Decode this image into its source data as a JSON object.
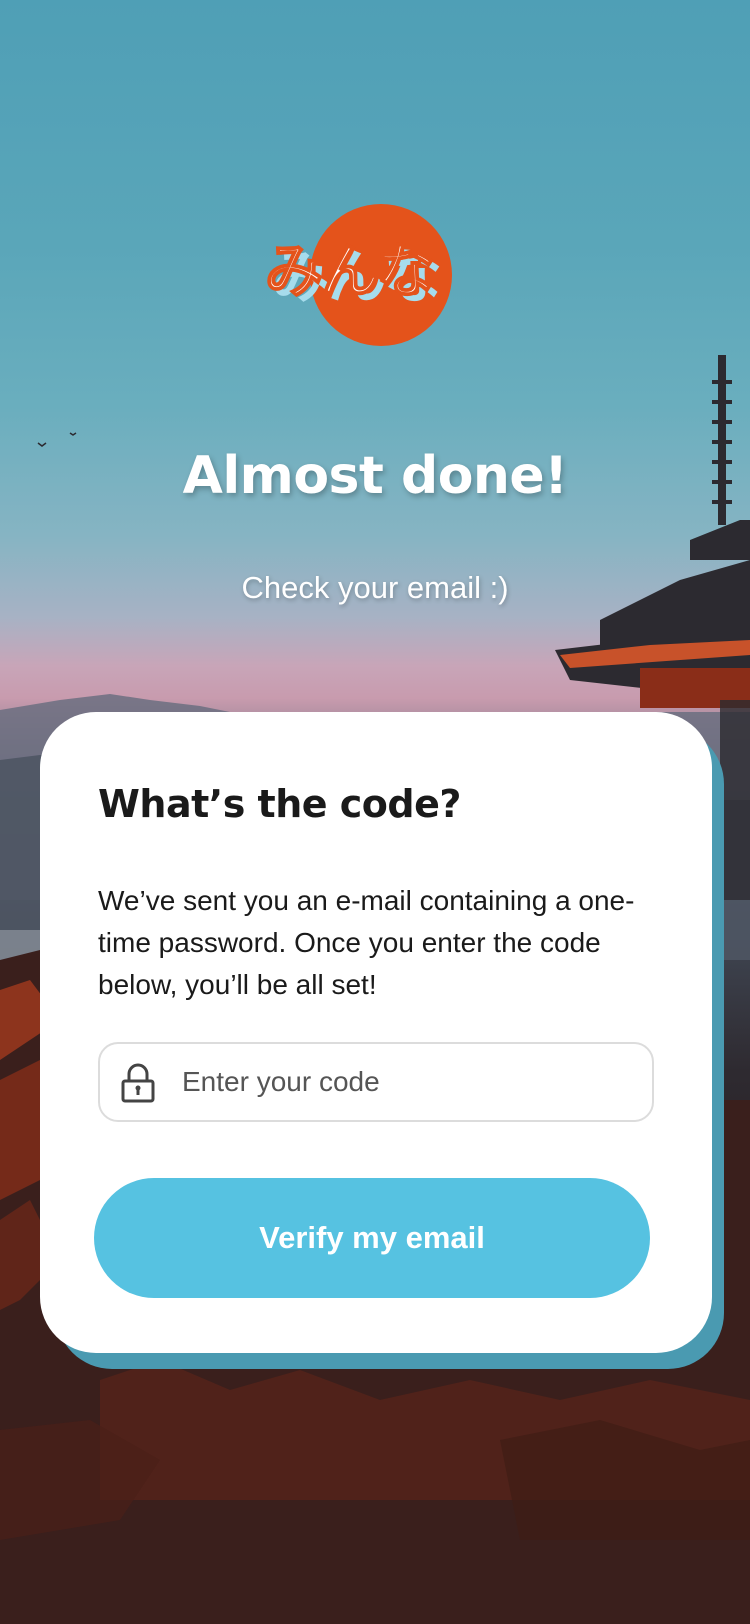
{
  "logo": {
    "text": "みんな",
    "colors": {
      "circle": "#e4531b",
      "text": "#ffffff",
      "shadow": "#a6dcec"
    }
  },
  "hero": {
    "title": "Almost done!",
    "subtitle": "Check your email :)"
  },
  "card": {
    "title": "What’s the code?",
    "body": "We’ve sent you an e-mail containing a one-time password. Once you enter the code below, you’ll be all set!",
    "code_field": {
      "placeholder": "Enter your code",
      "value": "",
      "icon": "lock-icon"
    },
    "verify_button": {
      "label": "Verify my email"
    }
  },
  "colors": {
    "accent": "#56c2e1",
    "card_shadow": "#4a9ab1",
    "brand": "#e4531b"
  }
}
